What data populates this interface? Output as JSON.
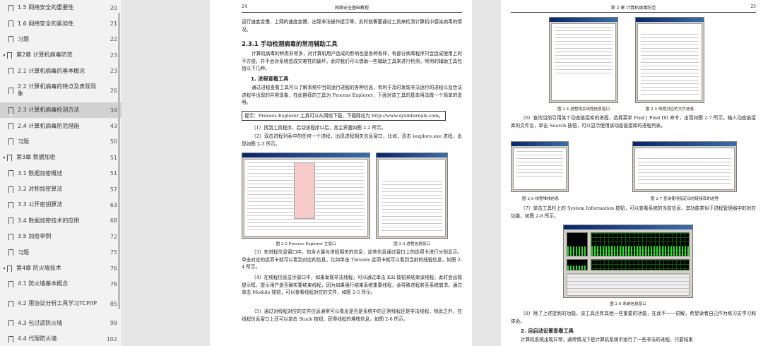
{
  "toc": [
    {
      "label": "1.5 网络安全的重要性",
      "page": "20",
      "level": 2
    },
    {
      "label": "1.6 网络安全的紧迫性",
      "page": "21",
      "level": 2
    },
    {
      "label": "习题",
      "page": "22",
      "level": 2
    },
    {
      "label": "第2章   计算机病毒防范",
      "page": "23",
      "level": 1
    },
    {
      "label": "2.1 计算机病毒的基本概念",
      "page": "23",
      "level": 2
    },
    {
      "label": "2.2 计算机病毒的特点及表现现象",
      "page": "26",
      "level": 2
    },
    {
      "label": "2.3 计算机病毒检测方法",
      "page": "34",
      "level": 2,
      "active": true
    },
    {
      "label": "2.4 计算机病毒防范措施",
      "page": "43",
      "level": 2
    },
    {
      "label": "习题",
      "page": "50",
      "level": 2
    },
    {
      "label": "第3章   数据加密",
      "page": "51",
      "level": 1
    },
    {
      "label": "3.1 数据加密概述",
      "page": "51",
      "level": 2
    },
    {
      "label": "3.2 对称加密算法",
      "page": "57",
      "level": 2
    },
    {
      "label": "3.3 公开密钥算法",
      "page": "63",
      "level": 2
    },
    {
      "label": "3.4 数据加密技术的应用",
      "page": "68",
      "level": 2
    },
    {
      "label": "3.5 加密举例",
      "page": "72",
      "level": 2
    },
    {
      "label": "习题",
      "page": "75",
      "level": 2
    },
    {
      "label": "第4章   防火墙技术",
      "page": "76",
      "level": 1
    },
    {
      "label": "4.1 防火墙基本概念",
      "page": "76",
      "level": 2
    },
    {
      "label": "4.2 用协议分析工具学习TCP/IP",
      "page": "85",
      "level": 2
    },
    {
      "label": "4.3 包过滤防火墙",
      "page": "99",
      "level": 2
    },
    {
      "label": "4.4 代理防火墙",
      "page": "102",
      "level": 2
    }
  ],
  "left_page": {
    "page_no": "24",
    "running_title": "网络安全基础教程",
    "p_intro": "运行速度变慢、上网的速度变慢、出现非法操作提示等，此时就需要通过工具来检测计算机中感染病毒的情况。",
    "h_231": "2.3.1   手动检测病毒的常用辅助工具",
    "p_231": "计算机病毒的种类非常多，对计算机用户造成的影响也是各种各样，有部分病毒程序只会造成使用上的不方便，并不会对系统造成灾难性的破坏，此时我们可以借助一些辅助工具来进行检测，常用的辅助工具包括以下几种。",
    "h_1": "1. 进程查看工具",
    "p_1": "通过进程查看工具可以了解系统中当前运行进程的各种信息，有利于及时发现非法运行的进程以及合法进程中出现的异常现象，在此推荐的工具为 Process Explorer，下面对该工具的基本用法做一个简单的说明。",
    "tip": "提示：Process Explorer 工具可以从网络下载，下载网站为 http://www.sysinternals.com。",
    "p_s1": "（1）找到工具程序，启动该程序以后，其主界面如图 2-2 所示。",
    "p_s2": "（2）双击进程列表中的任何一个进程，出现进程相关信息窗口，比如，双击 iexplore.exe 进程，出现如图 2-3 所示。",
    "cap_22": "图 2-2   Process Explorer 主窗口",
    "cap_23": "图 2-3   进程信息窗口",
    "p_s3": "（3）在进程信息窗口中，包含大量与进程相关的信息，这些信息通过窗口上的选项卡进行分别显示。单击对应的选项卡就可以看到对应的信息，比如单击 Threads 选项卡就可以看到当前的线程信息，如图 2-4 所示。",
    "p_s4": "（4）在线程信息显示窗口中，如果发现非法线程，可以通过单击 Kill 按钮来结束该线程，此时会出现提示框，提示用户是否确实要结束线程，因为如果强行结束系统重要线程，会导致进程甚至系统崩溃。通过单击 Module 按钮，可以查看线程对应的文件，如图 2-5 所示。",
    "p_s5": "（5）通过对线程对应的文件信息通常可以看出是否是系统中的正常线程还是非法线程，除此之外，在线程信息窗口上还可以单击 Stack 按钮，获得线程的堆栈信息，如图 2-6 所示。"
  },
  "right_page": {
    "page_no": "25",
    "running_title": "第 2 章   计算机病毒防范",
    "cap_24": "图 2-4   进程相关线程信息窗口",
    "cap_25": "图 2-5   线程对应的文件信息",
    "p_s6": "（6）查询当前引用某个动态链接库的进程，选择菜单 Find | Find Dll 命令，出现如图 2-7 所示。输入动态链接库的文件名，单击 Search 按钮，可以显示使用该动态链接库的进程列表。",
    "cap_26": "图 2-6   线程堆栈信息",
    "cap_27": "图 2-7   查询使用指定动态链接库的进程",
    "p_s7": "（7）单击工具栏上的 System Information 按钮，可以查看系统的当前信息，其功能类似于进程管理器中的对应功能，如图 2-8 所示。",
    "cap_28": "图 2-8   系统信息窗口",
    "p_s8": "（8）除了上述提到的功能，该工具还有其他一些重要的功能，在此不一一讲解，希望读者自己作为练习去学习和体会。",
    "h_2": "2. 自启动设置查看工具",
    "p_2": "计算机系统出现异常，通常情况下是计算机系统中运行了一些非法的进程，只要结束"
  }
}
